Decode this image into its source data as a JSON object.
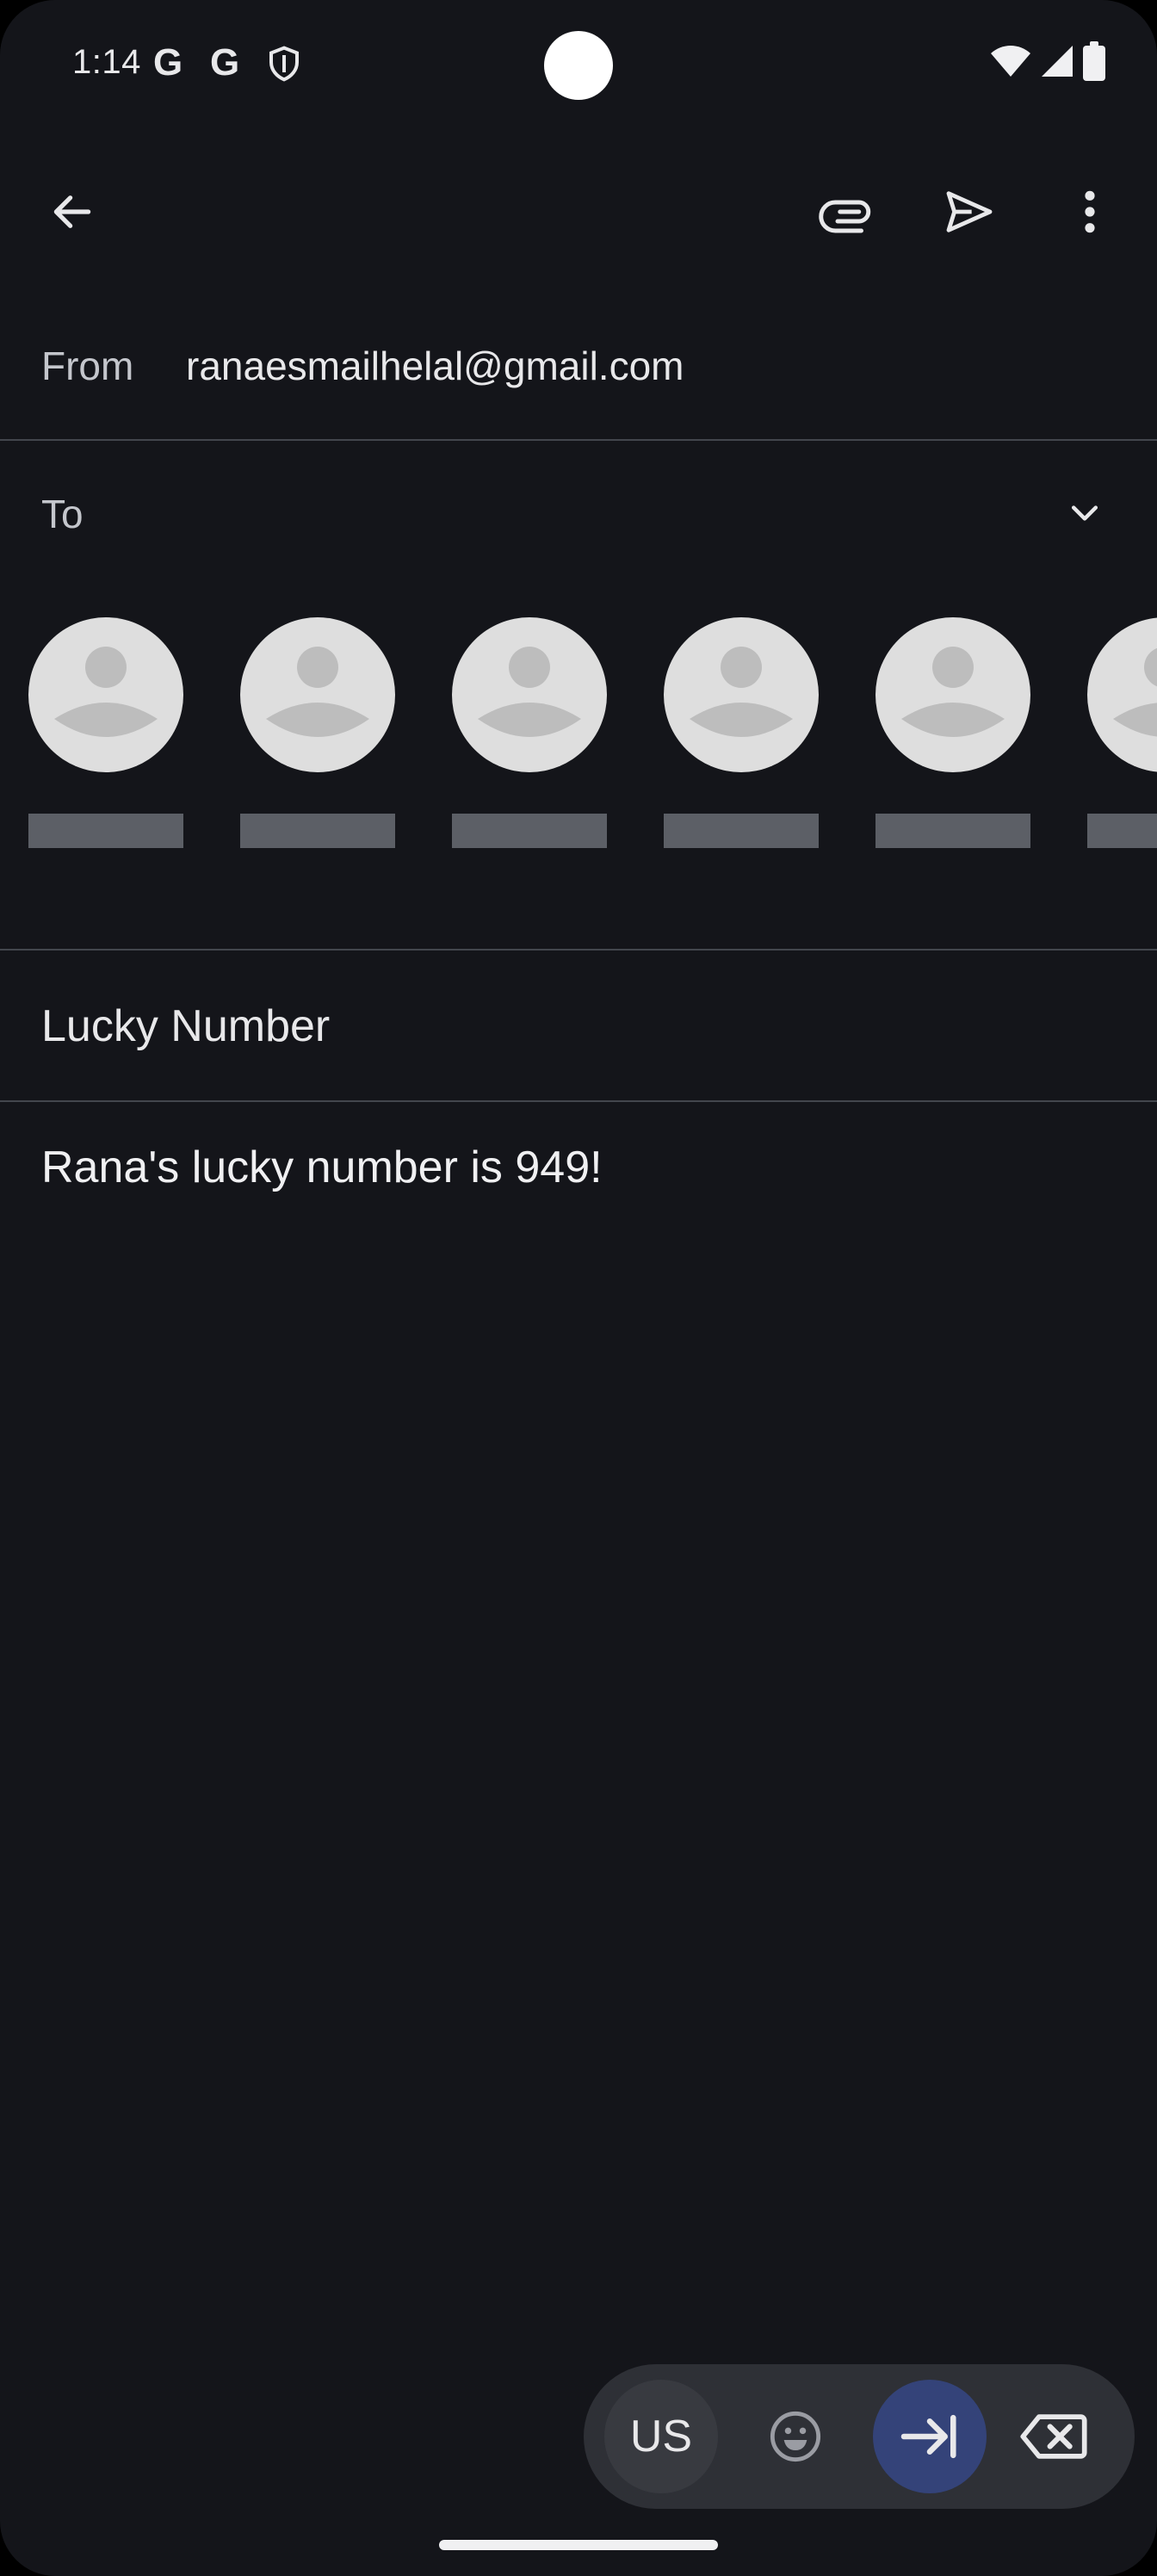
{
  "status_bar": {
    "time": "1:14",
    "google_letter_1": "G",
    "google_letter_2": "G"
  },
  "app_bar": {
    "back_icon": "arrow-back-icon",
    "attach_icon": "paperclip-icon",
    "send_icon": "send-icon",
    "more_icon": "more-vert-icon"
  },
  "compose": {
    "from_label": "From",
    "from_value": "ranaesmailhelal@gmail.com",
    "to_label": "To",
    "subject": "Lucky Number",
    "body": "Rana's lucky number is 949!"
  },
  "keyboard_toolbar": {
    "language": "US"
  },
  "colors": {
    "background": "#14151a",
    "divider": "#43464d",
    "text_primary": "#e8e8ea",
    "text_secondary": "#c4c6cc",
    "avatar_bg": "#dedede",
    "avatar_fg": "#bdbdbd",
    "accent_tab": "#344379"
  }
}
